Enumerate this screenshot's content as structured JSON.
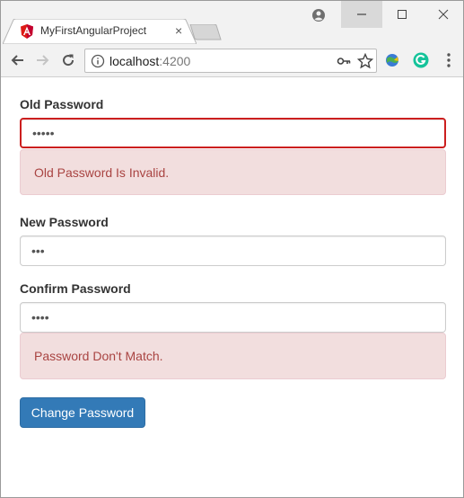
{
  "browser": {
    "tab_title": "MyFirstAngularProject",
    "tab_close": "×",
    "url_host": "localhost",
    "url_port": ":4200",
    "icons": {
      "favicon": "angular-icon",
      "profile": "profile-icon",
      "back": "back-arrow-icon",
      "forward": "forward-arrow-icon",
      "reload": "reload-icon",
      "info": "info-icon",
      "key": "key-icon",
      "star": "star-icon",
      "extension_1": "idm-extension-icon",
      "extension_2": "grammarly-icon",
      "menu": "menu-icon"
    }
  },
  "form": {
    "old_password": {
      "label": "Old Password",
      "value": "•••••",
      "error": "Old Password Is Invalid."
    },
    "new_password": {
      "label": "New Password",
      "value": "•••"
    },
    "confirm_password": {
      "label": "Confirm Password",
      "value": "••••",
      "error": "Password Don't Match."
    },
    "submit_label": "Change Password"
  },
  "colors": {
    "error_border": "#cc1f1f",
    "alert_bg": "#f2dede",
    "alert_text": "#a94442",
    "primary": "#337ab7"
  }
}
